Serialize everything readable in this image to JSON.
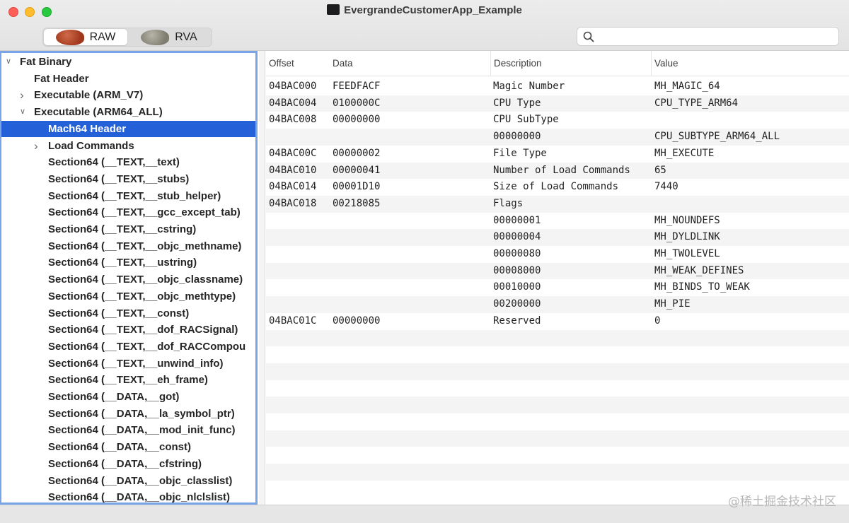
{
  "window": {
    "title": "EvergrandeCustomerApp_Example"
  },
  "mode_toggle": {
    "raw_label": "RAW",
    "rva_label": "RVA",
    "selected": "RAW"
  },
  "search": {
    "placeholder": "",
    "value": ""
  },
  "tree": {
    "items": [
      {
        "label": "Fat Binary",
        "level": 0,
        "expanded": true,
        "has_children": true
      },
      {
        "label": "Fat Header",
        "level": 1,
        "has_children": false
      },
      {
        "label": "Executable  (ARM_V7)",
        "level": 1,
        "expanded": false,
        "has_children": true
      },
      {
        "label": "Executable  (ARM64_ALL)",
        "level": 1,
        "expanded": true,
        "has_children": true
      },
      {
        "label": "Mach64 Header",
        "level": 2,
        "has_children": false,
        "selected": true
      },
      {
        "label": "Load Commands",
        "level": 2,
        "expanded": false,
        "has_children": true
      },
      {
        "label": "Section64 (__TEXT,__text)",
        "level": 2
      },
      {
        "label": "Section64 (__TEXT,__stubs)",
        "level": 2
      },
      {
        "label": "Section64 (__TEXT,__stub_helper)",
        "level": 2
      },
      {
        "label": "Section64 (__TEXT,__gcc_except_tab)",
        "level": 2
      },
      {
        "label": "Section64 (__TEXT,__cstring)",
        "level": 2
      },
      {
        "label": "Section64 (__TEXT,__objc_methname)",
        "level": 2
      },
      {
        "label": "Section64 (__TEXT,__ustring)",
        "level": 2
      },
      {
        "label": "Section64 (__TEXT,__objc_classname)",
        "level": 2
      },
      {
        "label": "Section64 (__TEXT,__objc_methtype)",
        "level": 2
      },
      {
        "label": "Section64 (__TEXT,__const)",
        "level": 2
      },
      {
        "label": "Section64 (__TEXT,__dof_RACSignal)",
        "level": 2
      },
      {
        "label": "Section64 (__TEXT,__dof_RACCompou",
        "level": 2
      },
      {
        "label": "Section64 (__TEXT,__unwind_info)",
        "level": 2
      },
      {
        "label": "Section64 (__TEXT,__eh_frame)",
        "level": 2
      },
      {
        "label": "Section64 (__DATA,__got)",
        "level": 2
      },
      {
        "label": "Section64 (__DATA,__la_symbol_ptr)",
        "level": 2
      },
      {
        "label": "Section64 (__DATA,__mod_init_func)",
        "level": 2
      },
      {
        "label": "Section64 (__DATA,__const)",
        "level": 2
      },
      {
        "label": "Section64 (__DATA,__cfstring)",
        "level": 2
      },
      {
        "label": "Section64 (__DATA,__objc_classlist)",
        "level": 2
      },
      {
        "label": "Section64 (__DATA,__objc_nlclslist)",
        "level": 2
      }
    ]
  },
  "table": {
    "columns": [
      "Offset",
      "Data",
      "Description",
      "Value"
    ],
    "rows": [
      [
        "04BAC000",
        "FEEDFACF",
        "Magic Number",
        "MH_MAGIC_64"
      ],
      [
        "04BAC004",
        "0100000C",
        "CPU Type",
        "CPU_TYPE_ARM64"
      ],
      [
        "04BAC008",
        "00000000",
        "CPU SubType",
        ""
      ],
      [
        "",
        "",
        "00000000",
        "CPU_SUBTYPE_ARM64_ALL"
      ],
      [
        "04BAC00C",
        "00000002",
        "File Type",
        "MH_EXECUTE"
      ],
      [
        "04BAC010",
        "00000041",
        "Number of Load Commands",
        "65"
      ],
      [
        "04BAC014",
        "00001D10",
        "Size of Load Commands",
        "7440"
      ],
      [
        "04BAC018",
        "00218085",
        "Flags",
        ""
      ],
      [
        "",
        "",
        "00000001",
        "MH_NOUNDEFS"
      ],
      [
        "",
        "",
        "00000004",
        "MH_DYLDLINK"
      ],
      [
        "",
        "",
        "00000080",
        "MH_TWOLEVEL"
      ],
      [
        "",
        "",
        "00008000",
        "MH_WEAK_DEFINES"
      ],
      [
        "",
        "",
        "00010000",
        "MH_BINDS_TO_WEAK"
      ],
      [
        "",
        "",
        "00200000",
        "MH_PIE"
      ],
      [
        "04BAC01C",
        "00000000",
        "Reserved",
        "0"
      ]
    ]
  },
  "watermark": "@稀土掘金技术社区",
  "colors": {
    "selection": "#2461d9",
    "tree_border": "#7aa4e8",
    "row_alt": "#f4f4f5"
  }
}
